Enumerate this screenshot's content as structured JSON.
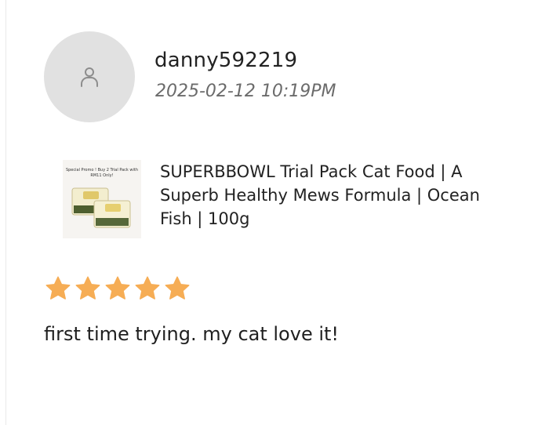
{
  "review": {
    "username": "danny592219",
    "timestamp": "2025-02-12 10:19PM",
    "product": {
      "name": "SUPERBBOWL Trial Pack Cat Food | A Superb Healthy Mews Formula | Ocean Fish | 100g",
      "thumbnail_text": "Special Promo ! Buy 2 Trial Pack with RM11 Only!"
    },
    "rating": 5,
    "rating_max": 5,
    "text": "first time trying. my cat love it!"
  },
  "colors": {
    "star": "#f6ad55",
    "avatar_bg": "#e1e1e1",
    "timestamp": "#6b6b6b"
  },
  "icons": {
    "avatar": "user-icon",
    "star": "star-icon"
  }
}
